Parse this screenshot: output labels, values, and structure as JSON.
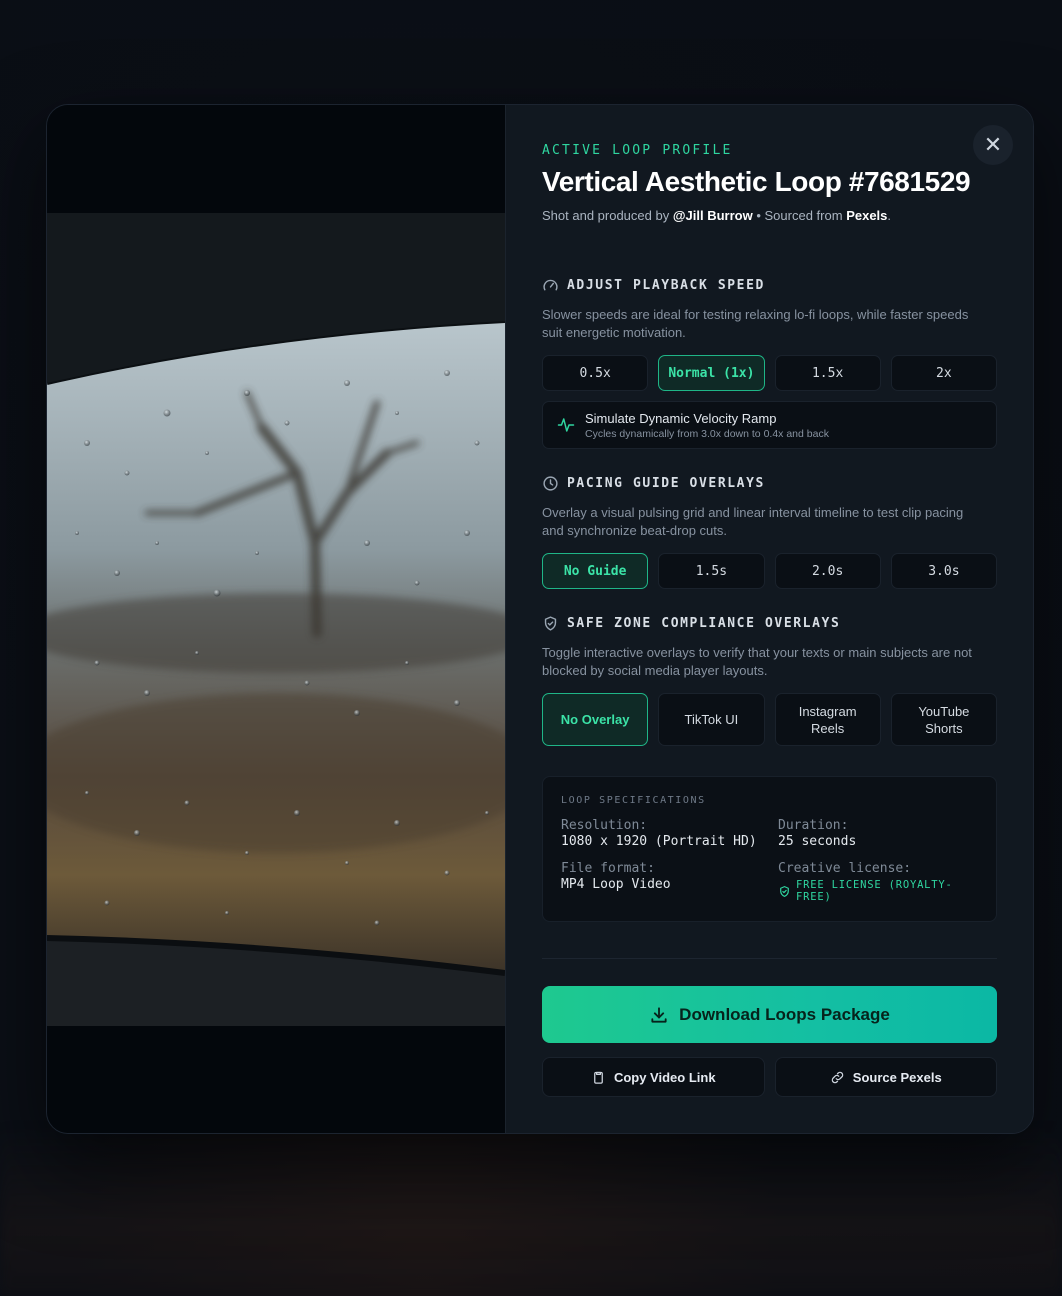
{
  "profile": {
    "eyebrow": "ACTIVE LOOP PROFILE",
    "title": "Vertical Aesthetic Loop #7681529",
    "credit_prefix": "Shot and produced by",
    "author": "@Jill Burrow",
    "bullet": "•",
    "source_prefix": "Sourced from",
    "source": "Pexels",
    "source_suffix": "."
  },
  "close": {
    "icon": "close-icon",
    "label": "✕"
  },
  "speed": {
    "heading": "ADJUST PLAYBACK SPEED",
    "icon": "gauge-icon",
    "description": "Slower speeds are ideal for testing relaxing lo-fi loops, while faster speeds suit energetic motivation.",
    "options": [
      "0.5x",
      "Normal (1x)",
      "1.5x",
      "2x"
    ],
    "selected": "Normal (1x)",
    "ramp": {
      "icon": "pulse-icon",
      "title": "Simulate Dynamic Velocity Ramp",
      "subtitle": "Cycles dynamically from 3.0x down to 0.4x and back"
    }
  },
  "pacing": {
    "heading": "PACING GUIDE OVERLAYS",
    "icon": "clock-icon",
    "description": "Overlay a visual pulsing grid and linear interval timeline to test clip pacing and synchronize beat-drop cuts.",
    "options": [
      "No Guide",
      "1.5s",
      "2.0s",
      "3.0s"
    ],
    "selected": "No Guide"
  },
  "safezone": {
    "heading": "SAFE ZONE COMPLIANCE OVERLAYS",
    "icon": "shield-icon",
    "description": "Toggle interactive overlays to verify that your texts or main subjects are not blocked by social media player layouts.",
    "options": [
      "No Overlay",
      "TikTok UI",
      "Instagram Reels",
      "YouTube Shorts"
    ],
    "selected": "No Overlay"
  },
  "specs": {
    "heading": "LOOP SPECIFICATIONS",
    "resolution_label": "Resolution:",
    "resolution": "1080 x 1920 (Portrait HD)",
    "duration_label": "Duration:",
    "duration": "25 seconds",
    "format_label": "File format:",
    "format": "MP4 Loop Video",
    "license_label": "Creative license:",
    "license": "FREE LICENSE (ROYALTY-FREE)",
    "license_icon": "shield-check-icon"
  },
  "actions": {
    "download": "Download Loops Package",
    "download_icon": "download-icon",
    "copy": "Copy Video Link",
    "copy_icon": "clipboard-icon",
    "source": "Source Pexels",
    "source_icon": "link-icon"
  },
  "colors": {
    "accent": "#2fd6a0",
    "panel": "#111820",
    "background": "#0a0e15"
  }
}
